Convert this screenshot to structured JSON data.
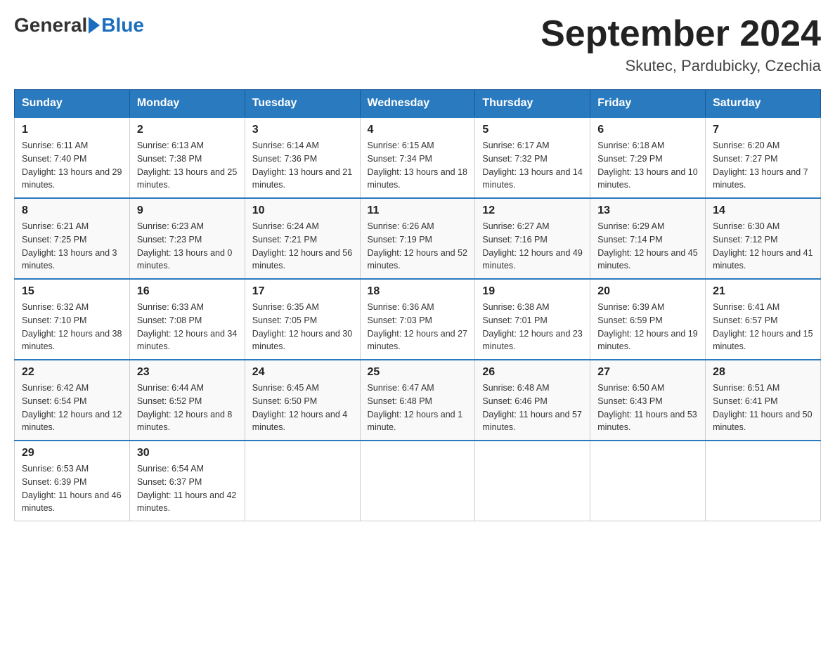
{
  "header": {
    "logo_general": "General",
    "logo_blue": "Blue",
    "month_title": "September 2024",
    "location": "Skutec, Pardubicky, Czechia"
  },
  "weekdays": [
    "Sunday",
    "Monday",
    "Tuesday",
    "Wednesday",
    "Thursday",
    "Friday",
    "Saturday"
  ],
  "weeks": [
    [
      {
        "day": "1",
        "sunrise": "6:11 AM",
        "sunset": "7:40 PM",
        "daylight": "13 hours and 29 minutes."
      },
      {
        "day": "2",
        "sunrise": "6:13 AM",
        "sunset": "7:38 PM",
        "daylight": "13 hours and 25 minutes."
      },
      {
        "day": "3",
        "sunrise": "6:14 AM",
        "sunset": "7:36 PM",
        "daylight": "13 hours and 21 minutes."
      },
      {
        "day": "4",
        "sunrise": "6:15 AM",
        "sunset": "7:34 PM",
        "daylight": "13 hours and 18 minutes."
      },
      {
        "day": "5",
        "sunrise": "6:17 AM",
        "sunset": "7:32 PM",
        "daylight": "13 hours and 14 minutes."
      },
      {
        "day": "6",
        "sunrise": "6:18 AM",
        "sunset": "7:29 PM",
        "daylight": "13 hours and 10 minutes."
      },
      {
        "day": "7",
        "sunrise": "6:20 AM",
        "sunset": "7:27 PM",
        "daylight": "13 hours and 7 minutes."
      }
    ],
    [
      {
        "day": "8",
        "sunrise": "6:21 AM",
        "sunset": "7:25 PM",
        "daylight": "13 hours and 3 minutes."
      },
      {
        "day": "9",
        "sunrise": "6:23 AM",
        "sunset": "7:23 PM",
        "daylight": "13 hours and 0 minutes."
      },
      {
        "day": "10",
        "sunrise": "6:24 AM",
        "sunset": "7:21 PM",
        "daylight": "12 hours and 56 minutes."
      },
      {
        "day": "11",
        "sunrise": "6:26 AM",
        "sunset": "7:19 PM",
        "daylight": "12 hours and 52 minutes."
      },
      {
        "day": "12",
        "sunrise": "6:27 AM",
        "sunset": "7:16 PM",
        "daylight": "12 hours and 49 minutes."
      },
      {
        "day": "13",
        "sunrise": "6:29 AM",
        "sunset": "7:14 PM",
        "daylight": "12 hours and 45 minutes."
      },
      {
        "day": "14",
        "sunrise": "6:30 AM",
        "sunset": "7:12 PM",
        "daylight": "12 hours and 41 minutes."
      }
    ],
    [
      {
        "day": "15",
        "sunrise": "6:32 AM",
        "sunset": "7:10 PM",
        "daylight": "12 hours and 38 minutes."
      },
      {
        "day": "16",
        "sunrise": "6:33 AM",
        "sunset": "7:08 PM",
        "daylight": "12 hours and 34 minutes."
      },
      {
        "day": "17",
        "sunrise": "6:35 AM",
        "sunset": "7:05 PM",
        "daylight": "12 hours and 30 minutes."
      },
      {
        "day": "18",
        "sunrise": "6:36 AM",
        "sunset": "7:03 PM",
        "daylight": "12 hours and 27 minutes."
      },
      {
        "day": "19",
        "sunrise": "6:38 AM",
        "sunset": "7:01 PM",
        "daylight": "12 hours and 23 minutes."
      },
      {
        "day": "20",
        "sunrise": "6:39 AM",
        "sunset": "6:59 PM",
        "daylight": "12 hours and 19 minutes."
      },
      {
        "day": "21",
        "sunrise": "6:41 AM",
        "sunset": "6:57 PM",
        "daylight": "12 hours and 15 minutes."
      }
    ],
    [
      {
        "day": "22",
        "sunrise": "6:42 AM",
        "sunset": "6:54 PM",
        "daylight": "12 hours and 12 minutes."
      },
      {
        "day": "23",
        "sunrise": "6:44 AM",
        "sunset": "6:52 PM",
        "daylight": "12 hours and 8 minutes."
      },
      {
        "day": "24",
        "sunrise": "6:45 AM",
        "sunset": "6:50 PM",
        "daylight": "12 hours and 4 minutes."
      },
      {
        "day": "25",
        "sunrise": "6:47 AM",
        "sunset": "6:48 PM",
        "daylight": "12 hours and 1 minute."
      },
      {
        "day": "26",
        "sunrise": "6:48 AM",
        "sunset": "6:46 PM",
        "daylight": "11 hours and 57 minutes."
      },
      {
        "day": "27",
        "sunrise": "6:50 AM",
        "sunset": "6:43 PM",
        "daylight": "11 hours and 53 minutes."
      },
      {
        "day": "28",
        "sunrise": "6:51 AM",
        "sunset": "6:41 PM",
        "daylight": "11 hours and 50 minutes."
      }
    ],
    [
      {
        "day": "29",
        "sunrise": "6:53 AM",
        "sunset": "6:39 PM",
        "daylight": "11 hours and 46 minutes."
      },
      {
        "day": "30",
        "sunrise": "6:54 AM",
        "sunset": "6:37 PM",
        "daylight": "11 hours and 42 minutes."
      },
      null,
      null,
      null,
      null,
      null
    ]
  ],
  "labels": {
    "sunrise": "Sunrise:",
    "sunset": "Sunset:",
    "daylight": "Daylight:"
  }
}
